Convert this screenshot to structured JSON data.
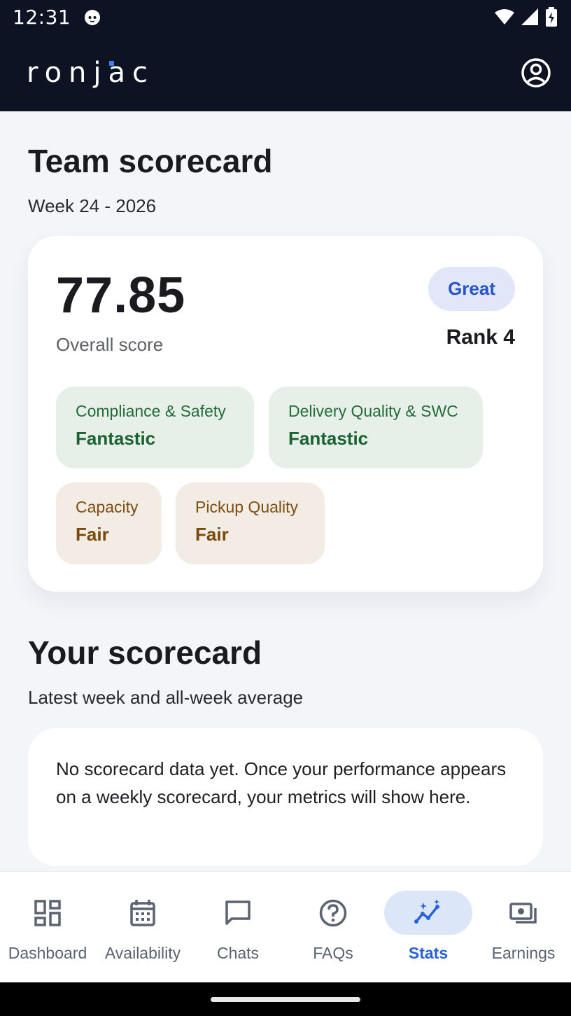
{
  "status_bar": {
    "time": "12:31"
  },
  "app_bar": {
    "logo_text": "ronjac"
  },
  "team_scorecard": {
    "title": "Team scorecard",
    "subtitle": "Week 24 - 2026",
    "score": "77.85",
    "score_label": "Overall score",
    "badge": "Great",
    "rank": "Rank 4",
    "metrics": [
      {
        "label": "Compliance & Safety",
        "value": "Fantastic",
        "tone": "green"
      },
      {
        "label": "Delivery Quality & SWC",
        "value": "Fantastic",
        "tone": "green"
      },
      {
        "label": "Capacity",
        "value": "Fair",
        "tone": "tan"
      },
      {
        "label": "Pickup Quality",
        "value": "Fair",
        "tone": "tan"
      }
    ]
  },
  "your_scorecard": {
    "title": "Your scorecard",
    "subtitle": "Latest week and all-week average",
    "empty_message": "No scorecard data yet. Once your performance appears on a weekly scorecard, your metrics will show here."
  },
  "bottom_nav": {
    "items": [
      {
        "label": "Dashboard",
        "icon": "dashboard-icon"
      },
      {
        "label": "Availability",
        "icon": "calendar-icon"
      },
      {
        "label": "Chats",
        "icon": "chat-icon"
      },
      {
        "label": "FAQs",
        "icon": "help-icon"
      },
      {
        "label": "Stats",
        "icon": "insights-icon",
        "active": true
      },
      {
        "label": "Earnings",
        "icon": "payments-icon"
      }
    ]
  },
  "colors": {
    "app_bar": "#0d1323",
    "accent": "#2a61d6",
    "fantastic_bg": "#e6f0e9",
    "fair_bg": "#f3ece4"
  }
}
